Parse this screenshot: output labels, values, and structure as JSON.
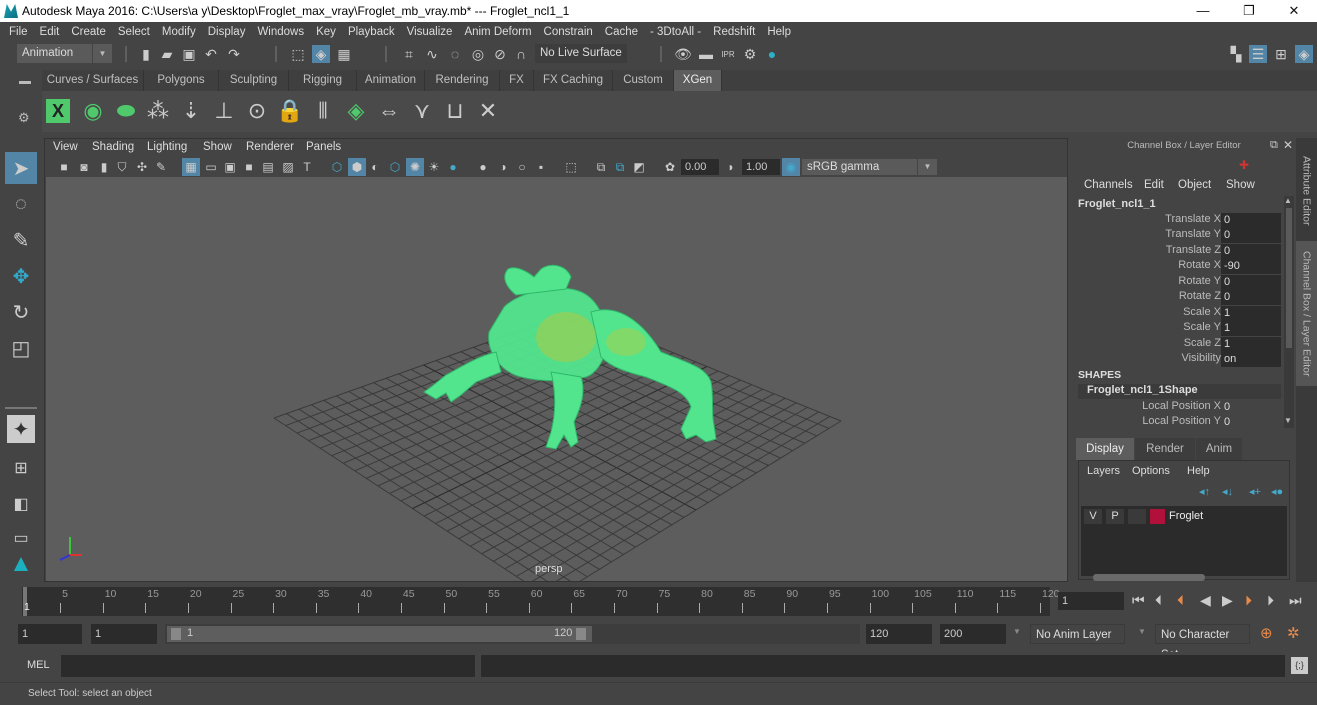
{
  "window": {
    "title": "Autodesk Maya 2016: C:\\Users\\a y\\Desktop\\Froglet_max_vray\\Froglet_mb_vray.mb*   ---   Froglet_ncl1_1",
    "minimize": "—",
    "restore": "❐",
    "close": "✕"
  },
  "menubar": [
    "File",
    "Edit",
    "Create",
    "Select",
    "Modify",
    "Display",
    "Windows",
    "Key",
    "Playback",
    "Visualize",
    "Anim Deform",
    "Constrain",
    "Cache",
    "- 3DtoAll -",
    "Redshift",
    "Help"
  ],
  "statusline": {
    "mode": "Animation",
    "live_surface": "No Live Surface"
  },
  "shelf": {
    "tabs": [
      "Curves / Surfaces",
      "Polygons",
      "Sculpting",
      "Rigging",
      "Animation",
      "Rendering",
      "FX",
      "FX Caching",
      "Custom",
      "XGen"
    ],
    "active_tab": "XGen"
  },
  "viewport": {
    "menus": [
      "View",
      "Shading",
      "Lighting",
      "Show",
      "Renderer",
      "Panels"
    ],
    "exposure": "0.00",
    "gamma": "1.00",
    "color_space": "sRGB gamma",
    "camera": "persp",
    "axis": {
      "x": "x",
      "y": "Y",
      "z": "z"
    }
  },
  "channelbox": {
    "title": "Channel Box / Layer Editor",
    "menus": [
      "Channels",
      "Edit",
      "Object",
      "Show"
    ],
    "object": "Froglet_ncl1_1",
    "channels": [
      {
        "name": "Translate X",
        "value": "0"
      },
      {
        "name": "Translate Y",
        "value": "0"
      },
      {
        "name": "Translate Z",
        "value": "0"
      },
      {
        "name": "Rotate X",
        "value": "-90"
      },
      {
        "name": "Rotate Y",
        "value": "0"
      },
      {
        "name": "Rotate Z",
        "value": "0"
      },
      {
        "name": "Scale X",
        "value": "1"
      },
      {
        "name": "Scale Y",
        "value": "1"
      },
      {
        "name": "Scale Z",
        "value": "1"
      },
      {
        "name": "Visibility",
        "value": "on"
      }
    ],
    "shapes_header": "SHAPES",
    "shape_name": "Froglet_ncl1_1Shape",
    "shape_channels": [
      {
        "name": "Local Position X",
        "value": "0"
      },
      {
        "name": "Local Position Y",
        "value": "0"
      }
    ]
  },
  "layereditor": {
    "tabs": [
      "Display",
      "Render",
      "Anim"
    ],
    "active_tab": "Display",
    "menus": [
      "Layers",
      "Options",
      "Help"
    ],
    "layers": [
      {
        "v": "V",
        "p": "P",
        "color": "#b0103a",
        "name": "Froglet"
      }
    ]
  },
  "sidetabs": [
    "Attribute Editor",
    "Channel Box / Layer Editor"
  ],
  "timeline": {
    "ticks": [
      5,
      10,
      15,
      20,
      25,
      30,
      35,
      40,
      45,
      50,
      55,
      60,
      65,
      70,
      75,
      80,
      85,
      90,
      95,
      100,
      105,
      110,
      115,
      120
    ],
    "current_frame": "1",
    "start": 1,
    "end": 120,
    "current_field": "1"
  },
  "range": {
    "start_time": "1",
    "playback_start": "1",
    "slider_start": "1",
    "slider_end": "120",
    "playback_end": "120",
    "end_time": "200",
    "anim_layer": "No Anim Layer",
    "character_set": "No Character Set"
  },
  "commandline": {
    "label": "MEL",
    "input": "",
    "result": ""
  },
  "helpline": {
    "text": "Select Tool: select an object"
  }
}
